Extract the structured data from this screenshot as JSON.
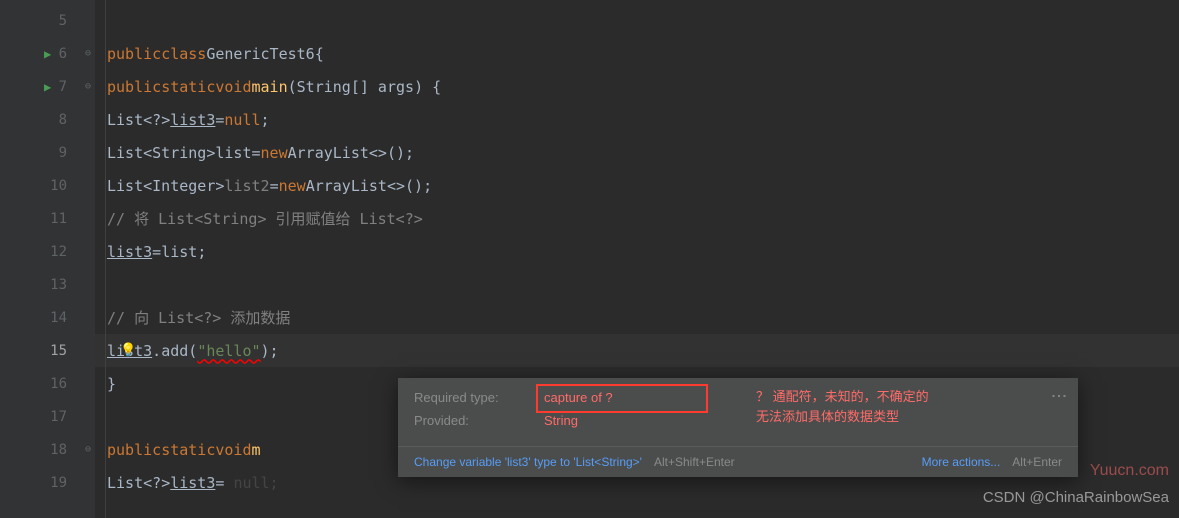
{
  "lines": {
    "n5": "5",
    "n6": "6",
    "n7": "7",
    "n8": "8",
    "n9": "9",
    "n10": "10",
    "n11": "11",
    "n12": "12",
    "n13": "13",
    "n14": "14",
    "n15": "15",
    "n16": "16",
    "n17": "17",
    "n18": "18",
    "n19": "19"
  },
  "code": {
    "l6_kw1": "public",
    "l6_kw2": "class",
    "l6_cls": "GenericTest6",
    "l7_kw1": "public",
    "l7_kw2": "static",
    "l7_kw3": "void",
    "l7_m": "main",
    "l7_args": "String[] args",
    "l8_t": "List",
    "l8_g": "?",
    "l8_v": "list3",
    "l8_null": "null",
    "l9_t": "List",
    "l9_g": "String",
    "l9_v": "list",
    "l9_new": "new",
    "l9_c": "ArrayList",
    "l10_t": "List",
    "l10_g": "Integer",
    "l10_v": "list2",
    "l10_new": "new",
    "l10_c": "ArrayList",
    "l11_c": "// 将 List<String> 引用赋值给 List<?>",
    "l12_v1": "list3",
    "l12_v2": "list",
    "l14_c": "// 向 List<?> 添加数据",
    "l15_v": "list3",
    "l15_m": "add",
    "l15_s": "\"hello\"",
    "l18_kw1": "public",
    "l18_kw2": "static",
    "l18_kw3": "void",
    "l18_m": "m",
    "l19_t": "List",
    "l19_g": "?",
    "l19_v": "list3",
    "l19_rest": "null;"
  },
  "tooltip": {
    "label1": "Required type:",
    "val1": "capture of ?",
    "label2": "Provided:",
    "val2": "String",
    "note1": "？ 通配符，未知的，不确定的",
    "note2": "无法添加具体的数据类型",
    "action1": "Change variable 'list3' type to 'List<String>'",
    "shortcut1": "Alt+Shift+Enter",
    "action2": "More actions...",
    "shortcut2": "Alt+Enter"
  },
  "watermark1": "Yuucn.com",
  "watermark2": "CSDN @ChinaRainbowSea"
}
